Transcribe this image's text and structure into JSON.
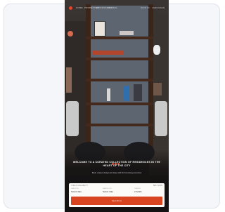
{
  "nav": {
    "links": [
      "HOME",
      "PROPERTIES",
      "EXPERIENCES",
      "JOURNAL"
    ],
    "right_links": [
      "SIGN IN",
      "LANGUAGE"
    ]
  },
  "hero": {
    "headline": "WELCOME TO A CURATED COLLECTION OF RESIDENCES IN THE HEART OF THE CITY",
    "subline": "Book unique design-led stays with full concierge services"
  },
  "search": {
    "title": "CHECK AVAILABILITY",
    "right": "BEST RATE",
    "fields": [
      {
        "label": "CHECK IN",
        "value": "Select date"
      },
      {
        "label": "CHECK OUT",
        "value": "Select date"
      },
      {
        "label": "GUESTS",
        "value": "2 Adults"
      }
    ],
    "submit_label": "SEARCH"
  },
  "colors": {
    "accent": "#d8441f",
    "background": "#2a2624",
    "card": "#f4f6f9"
  }
}
